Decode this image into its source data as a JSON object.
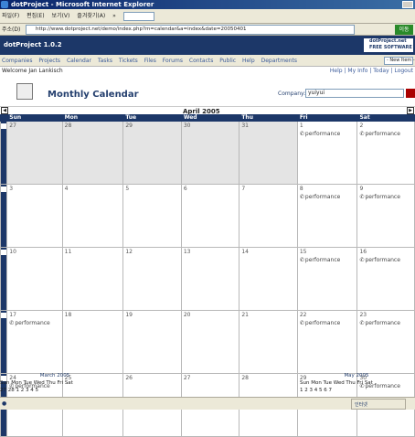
{
  "window": {
    "title": "dotProject - Microsoft Internet Explorer"
  },
  "menubar": {
    "items": [
      "파일(F)",
      "편집(E)",
      "보기(V)",
      "즐겨찾기(A)",
      "»"
    ]
  },
  "address": {
    "url": "http://www.dotproject.net/demo/index.php?m=calendar&a=index&date=20050401",
    "label": "주소(D)",
    "go_label": "이동"
  },
  "app": {
    "title": "dotProject 1.0.2",
    "logo_text": "dotProject.net FREE SOFTWARE"
  },
  "nav": {
    "items": [
      "Companies",
      "Projects",
      "Calendar",
      "Tasks",
      "Tickets",
      "Files",
      "Forums",
      "Contacts",
      "Public",
      "Help",
      "Departments"
    ],
    "new_item": "- New Item -"
  },
  "user": {
    "welcome": "Welcome Jan Lankisch",
    "links": "Help | My Info | Today | Logout"
  },
  "page": {
    "title": "Monthly Calendar",
    "company_label": "Company:",
    "company_value": "yuiyui"
  },
  "calendar": {
    "month_title": "April 2005",
    "days": [
      "Sun",
      "Mon",
      "Tue",
      "Wed",
      "Thu",
      "Fri",
      "Sat"
    ],
    "weeks": [
      [
        {
          "d": "27",
          "o": true,
          "e": ""
        },
        {
          "d": "28",
          "o": true,
          "e": ""
        },
        {
          "d": "29",
          "o": true,
          "e": ""
        },
        {
          "d": "30",
          "o": true,
          "e": ""
        },
        {
          "d": "31",
          "o": true,
          "e": ""
        },
        {
          "d": "1",
          "o": false,
          "e": "performance"
        },
        {
          "d": "2",
          "o": false,
          "e": "performance"
        }
      ],
      [
        {
          "d": "3",
          "o": false,
          "e": ""
        },
        {
          "d": "4",
          "o": false,
          "e": ""
        },
        {
          "d": "5",
          "o": false,
          "e": ""
        },
        {
          "d": "6",
          "o": false,
          "e": ""
        },
        {
          "d": "7",
          "o": false,
          "e": ""
        },
        {
          "d": "8",
          "o": false,
          "e": "performance"
        },
        {
          "d": "9",
          "o": false,
          "e": "performance"
        }
      ],
      [
        {
          "d": "10",
          "o": false,
          "e": ""
        },
        {
          "d": "11",
          "o": false,
          "e": ""
        },
        {
          "d": "12",
          "o": false,
          "e": ""
        },
        {
          "d": "13",
          "o": false,
          "e": ""
        },
        {
          "d": "14",
          "o": false,
          "e": ""
        },
        {
          "d": "15",
          "o": false,
          "e": "performance"
        },
        {
          "d": "16",
          "o": false,
          "e": "performance"
        }
      ],
      [
        {
          "d": "17",
          "o": false,
          "e": "performance"
        },
        {
          "d": "18",
          "o": false,
          "e": ""
        },
        {
          "d": "19",
          "o": false,
          "e": ""
        },
        {
          "d": "20",
          "o": false,
          "e": ""
        },
        {
          "d": "21",
          "o": false,
          "e": ""
        },
        {
          "d": "22",
          "o": false,
          "e": "performance"
        },
        {
          "d": "23",
          "o": false,
          "e": "performance"
        }
      ],
      [
        {
          "d": "24",
          "o": false,
          "e": "performance"
        },
        {
          "d": "25",
          "o": false,
          "e": ""
        },
        {
          "d": "26",
          "o": false,
          "e": ""
        },
        {
          "d": "27",
          "o": false,
          "e": ""
        },
        {
          "d": "28",
          "o": false,
          "e": ""
        },
        {
          "d": "29",
          "o": false,
          "e": ""
        },
        {
          "d": "30",
          "o": false,
          "e": "performance"
        }
      ]
    ]
  },
  "mini": {
    "prev": {
      "title": "March 2005",
      "days": "Sun Mon Tue Wed Thu Fri Sat",
      "row": "27  28  1   2   3   4   5"
    },
    "next": {
      "title": "May 2005",
      "days": "Sun Mon Tue Wed Thu Fri Sat",
      "row": "1   2   3   4   5   6   7"
    }
  },
  "status": {
    "zone": "인터넷"
  }
}
